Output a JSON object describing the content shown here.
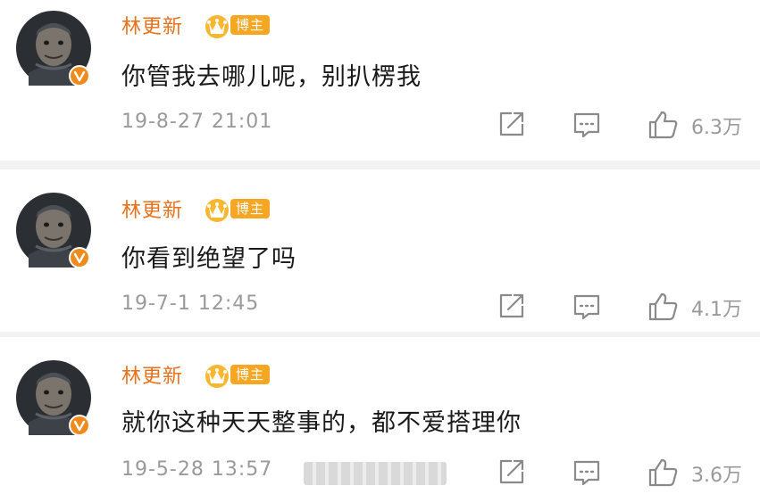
{
  "comments": [
    {
      "username": "林更新",
      "badge": "博主",
      "text": "你管我去哪儿呢，别扒楞我",
      "time": "19-8-27 21:01",
      "likes": "6.3万"
    },
    {
      "username": "林更新",
      "badge": "博主",
      "text": "你看到绝望了吗",
      "time": "19-7-1 12:45",
      "likes": "4.1万"
    },
    {
      "username": "林更新",
      "badge": "博主",
      "text": "就你这种天天整事的，都不爱搭理你",
      "time": "19-5-28 13:57",
      "likes": "3.6万"
    }
  ],
  "colors": {
    "username": "#e8721c",
    "badge": "#f5a623",
    "verified": "#f08a1c",
    "meta": "#9a9a9a",
    "text": "#1a1a1a"
  },
  "icons": {
    "share": "share-icon",
    "comment": "comment-icon",
    "like": "thumbs-up-icon",
    "verified": "verified-v-icon",
    "crown": "crown-icon"
  }
}
